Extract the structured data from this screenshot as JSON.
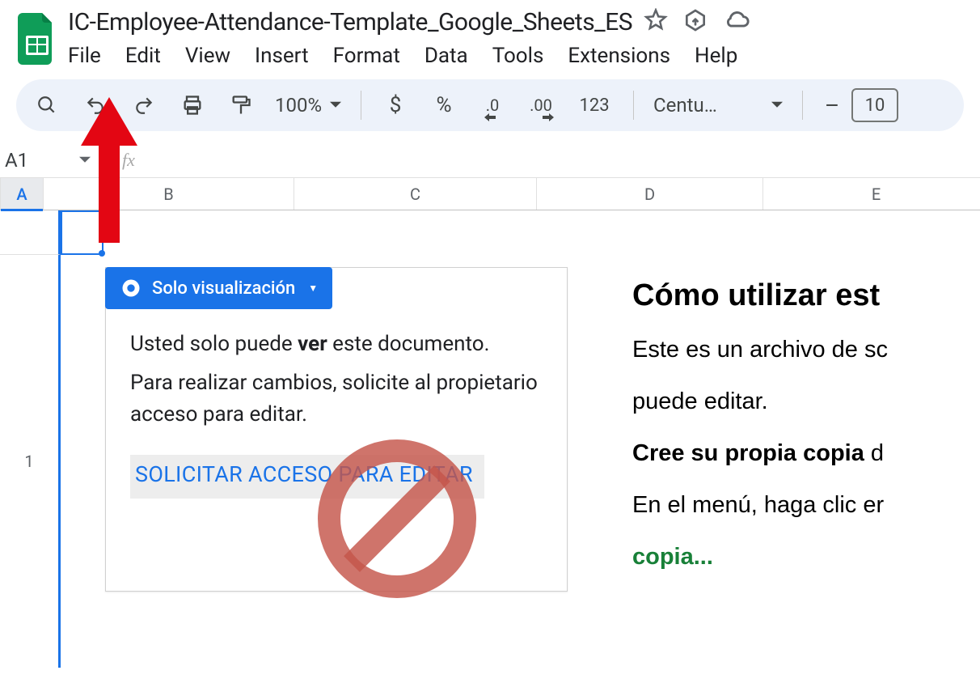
{
  "doc": {
    "title": "IC-Employee-Attendance-Template_Google_Sheets_ES"
  },
  "menu": {
    "file": "File",
    "edit": "Edit",
    "view": "View",
    "insert": "Insert",
    "format": "Format",
    "data": "Data",
    "tools": "Tools",
    "extensions": "Extensions",
    "help": "Help"
  },
  "toolbar": {
    "zoom": "100%",
    "currency": "$",
    "percent": "%",
    "dec_less": ".0",
    "dec_more": ".00",
    "num_format": "123",
    "font": "Centu…",
    "font_size": "10",
    "minus": "–"
  },
  "name_box": {
    "ref": "A1",
    "fx": "fx"
  },
  "cols": {
    "A": "A",
    "B": "B",
    "C": "C",
    "D": "D",
    "E": "E"
  },
  "rows": {
    "r1": "1"
  },
  "card": {
    "badge": "Solo visualización",
    "line1_pre": "Usted solo puede ",
    "line1_bold": "ver",
    "line1_post": " este documento.",
    "line2": "Para realizar cambios, solicite al propietario acceso para editar.",
    "request": "SOLICITAR ACCESO PARA EDITAR"
  },
  "right": {
    "heading": "Cómo utilizar est",
    "p1": "Este es un archivo de sc",
    "p1b": "puede editar.",
    "p2_bold": "Cree su propia copia",
    "p2_tail": " d",
    "p3": "En el menú, haga clic er",
    "p4_green": "copia..."
  }
}
